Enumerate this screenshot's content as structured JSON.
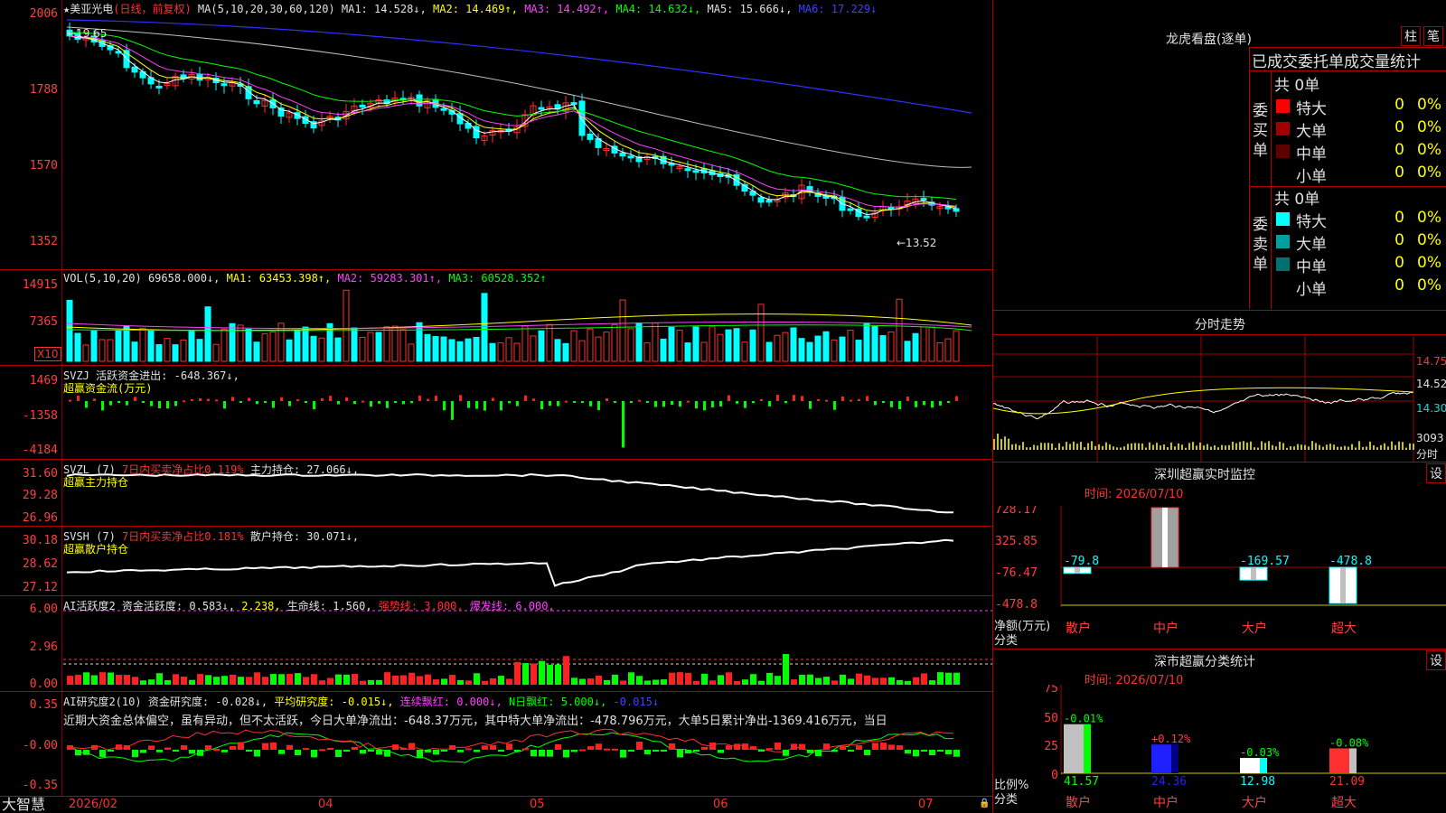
{
  "stock": {
    "title": "★美亚光电",
    "period": "(日线，前复权)",
    "ma_label": "MA(5,10,20,30,60,120)",
    "ma1": "MA1: 14.528↓,",
    "ma2": "MA2: 14.469↑,",
    "ma3": "MA3: 14.492↑,",
    "ma4": "MA4: 14.632↓,",
    "ma5": "MA5: 15.666↓,",
    "ma6": "MA6: 17.229↓",
    "high_mark": "←19.65",
    "low_mark": "←13.52",
    "y_labels": [
      "2006",
      "1788",
      "1570",
      "1352"
    ]
  },
  "volume": {
    "label": "VOL(5,10,20)",
    "val": "69658.000↓,",
    "ma1": "MA1: 63453.398↑,",
    "ma2": "MA2: 59283.301↑,",
    "ma3": "MA3: 60528.352↑",
    "y_labels": [
      "14915",
      "7365"
    ],
    "unit": "X10"
  },
  "svzj": {
    "label": "SVZJ",
    "desc": "活跃资金进出: -648.367↓,",
    "sub": "超赢资金流(万元)",
    "y_labels": [
      "1469",
      "-1358",
      "-4184"
    ]
  },
  "svzl": {
    "label": "SVZL (7)",
    "desc": "7日内买卖净占比0.119%",
    "hold": "主力持仓: 27.066↓,",
    "sub": "超赢主力持仓",
    "y_labels": [
      "31.60",
      "29.28",
      "26.96"
    ]
  },
  "svsh": {
    "label": "SVSH (7)",
    "desc": "7日内买卖净占比0.181%",
    "hold": "散户持仓: 30.071↓,",
    "sub": "超赢散户持仓",
    "y_labels": [
      "30.18",
      "28.62",
      "27.12"
    ]
  },
  "ai_active": {
    "label": "AI活跃度2",
    "a": "资金活跃度: 0.583↓,",
    "b": "2.238,",
    "c": "生命线: 1.560,",
    "d": "强势线: 3.000,",
    "e": "爆发线: 6.000,",
    "y_labels": [
      "6.00",
      "2.96",
      "0.00"
    ]
  },
  "ai_research": {
    "label": "AI研究度2(10)",
    "a": "资金研究度: -0.028↓,",
    "b": "平均研究度: -0.015↓,",
    "c": "连续飘红: 0.000↓,",
    "d": "N日飘红: 5.000↓,",
    "e": "-0.015↓",
    "note": "近期大资金总体偏空，虽有异动，但不太活跃，今日大单净流出：-648.37万元，其中特大单净流出：-478.796万元，大单5日累计净出-1369.416万元，当日",
    "y_labels": [
      "0.35",
      "-0.00",
      "-0.35"
    ]
  },
  "xaxis": {
    "brand": "大智慧",
    "labels": [
      "2026/02",
      "04",
      "05",
      "06",
      "07"
    ]
  },
  "longhu": {
    "title": "龙虎看盘(逐单)",
    "btn1": "柱",
    "btn2": "笔",
    "header": "已成交委托单成交量统计",
    "buy_side": "委买单",
    "sell_side": "委卖单",
    "buy_total": "共 0单",
    "sell_total": "共 0单",
    "buy_rows": [
      {
        "name": "特大",
        "count": "0",
        "pct": "0%",
        "color": "#ff0000"
      },
      {
        "name": "大单",
        "count": "0",
        "pct": "0%",
        "color": "#a00000"
      },
      {
        "name": "中单",
        "count": "0",
        "pct": "0%",
        "color": "#600000"
      },
      {
        "name": "小单",
        "count": "0",
        "pct": "0%",
        "color": ""
      }
    ],
    "sell_rows": [
      {
        "name": "特大",
        "count": "0",
        "pct": "0%",
        "color": "#00ffff"
      },
      {
        "name": "大单",
        "count": "0",
        "pct": "0%",
        "color": "#00a0a0"
      },
      {
        "name": "中单",
        "count": "0",
        "pct": "0%",
        "color": "#007070"
      },
      {
        "name": "小单",
        "count": "0",
        "pct": "0%",
        "color": ""
      }
    ]
  },
  "fenshi": {
    "title": "分时走势",
    "y_labels": [
      "14.75",
      "14.52",
      "14.30"
    ],
    "vol_label": "3093",
    "vol_unit": "分时"
  },
  "sz_monitor": {
    "title": "深圳超赢实时监控",
    "btn": "设",
    "time": "时间: 2026/07/10",
    "y_labels": [
      "728.17",
      "325.85",
      "-76.47",
      "-478.8"
    ],
    "axis_title": "净额(万元)",
    "axis_sub": "分类",
    "bars": [
      {
        "cat": "散户",
        "value": -79.8,
        "label": "-79.8"
      },
      {
        "cat": "中户",
        "value": 728.17,
        "label": "728.17"
      },
      {
        "cat": "大户",
        "value": -169.57,
        "label": "-169.57"
      },
      {
        "cat": "超大",
        "value": -478.8,
        "label": "-478.8"
      }
    ]
  },
  "sz_stats": {
    "title": "深市超赢分类统计",
    "btn": "设",
    "time": "时间: 2026/07/10",
    "y_labels": [
      "75",
      "50",
      "25",
      "0"
    ],
    "axis_title": "比例%",
    "axis_sub": "分类",
    "bars": [
      {
        "cat": "散户",
        "value": 41.57,
        "change": "-0.01%",
        "label": "41.57"
      },
      {
        "cat": "中户",
        "value": 24.36,
        "change": "+0.12%",
        "label": "24.36"
      },
      {
        "cat": "大户",
        "value": 12.98,
        "change": "-0.03%",
        "label": "12.98"
      },
      {
        "cat": "超大",
        "value": 21.09,
        "change": "-0.08%",
        "label": "21.09"
      }
    ]
  }
}
